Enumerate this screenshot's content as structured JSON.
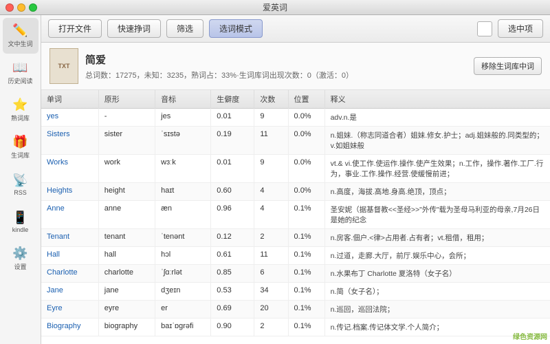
{
  "titlebar": {
    "title": "爱英词"
  },
  "toolbar": {
    "open_file": "打开文件",
    "quick_lookup": "快速挣词",
    "filter": "筛选",
    "select_mode": "选词模式",
    "select_item": "选中项"
  },
  "sidebar": {
    "items": [
      {
        "id": "text-words",
        "icon": "📝",
        "label": "文中生词"
      },
      {
        "id": "history",
        "icon": "📖",
        "label": "历史阅读"
      },
      {
        "id": "familiar",
        "icon": "⭐",
        "label": "熟词库"
      },
      {
        "id": "new-words",
        "icon": "🎁",
        "label": "生词库"
      },
      {
        "id": "rss",
        "icon": "📡",
        "label": "RSS"
      },
      {
        "id": "kindle",
        "icon": "📱",
        "label": "kindle"
      },
      {
        "id": "settings",
        "icon": "⚙️",
        "label": "设置"
      }
    ]
  },
  "book": {
    "cover_text": "TXT",
    "title": "简爱",
    "stats": "总词数：17275，未知：3235，熟词占：33%·生词库词出现次数：0（激活：0）",
    "move_btn": "移除生词库中词"
  },
  "table": {
    "headers": [
      "单词",
      "原形",
      "音标",
      "生僻度",
      "次数",
      "位置",
      "释义"
    ],
    "rows": [
      {
        "word": "yes",
        "base": "-",
        "phonetic": "jes",
        "rare": "0.01",
        "count": "9",
        "pos": "0.0%",
        "def": "adv.n.是"
      },
      {
        "word": "Sisters",
        "base": "sister",
        "phonetic": "ˈsɪstə",
        "rare": "0.19",
        "count": "11",
        "pos": "0.0%",
        "def": "n.姐妹.（称志同道合者）姐妹.修女.护士；adj.姐妹般的.同类型的；v.如姐妹般"
      },
      {
        "word": "Works",
        "base": "work",
        "phonetic": "wɜːk",
        "rare": "0.01",
        "count": "9",
        "pos": "0.0%",
        "def": "vt.& vi.使工作.使运作.操作.使产生效果；n.工作，操作.著作.工厂.行为，事业.工作.操作.经营.使缓慢前进；"
      },
      {
        "word": "Heights",
        "base": "height",
        "phonetic": "haɪt",
        "rare": "0.60",
        "count": "4",
        "pos": "0.0%",
        "def": "n.高度，海拔.高地.身高.绝顶，顶点；"
      },
      {
        "word": "Anne",
        "base": "anne",
        "phonetic": "æn",
        "rare": "0.96",
        "count": "4",
        "pos": "0.1%",
        "def": "圣安妮（据基督教<<圣经>>\"外传\"载为圣母马利亚的母亲,7月26日是她的纪念"
      },
      {
        "word": "Tenant",
        "base": "tenant",
        "phonetic": "ˈtenənt",
        "rare": "0.12",
        "count": "2",
        "pos": "0.1%",
        "def": "n.房客.佃户.<律>占用者.占有者；vt.租借，租用；"
      },
      {
        "word": "Hall",
        "base": "hall",
        "phonetic": "hɔl",
        "rare": "0.61",
        "count": "11",
        "pos": "0.1%",
        "def": "n.过道，走廊.大厅，前厅.娱乐中心，会所；"
      },
      {
        "word": "Charlotte",
        "base": "charlotte",
        "phonetic": "ˈʃɑːrlət",
        "rare": "0.85",
        "count": "6",
        "pos": "0.1%",
        "def": "n.水果布丁 Charlotte 夏洛特（女子名）"
      },
      {
        "word": "Jane",
        "base": "jane",
        "phonetic": "dʒeɪn",
        "rare": "0.53",
        "count": "34",
        "pos": "0.1%",
        "def": "n.简（女子名）；"
      },
      {
        "word": "Eyre",
        "base": "eyre",
        "phonetic": "er",
        "rare": "0.69",
        "count": "20",
        "pos": "0.1%",
        "def": "n.巡回，巡回法院；"
      },
      {
        "word": "Biography",
        "base": "biography",
        "phonetic": "baɪˈɒɡrəfi",
        "rare": "0.90",
        "count": "2",
        "pos": "0.1%",
        "def": "n.传记.档案.传记体文学.个人简介；"
      }
    ]
  },
  "watermark": "绿色资源网"
}
